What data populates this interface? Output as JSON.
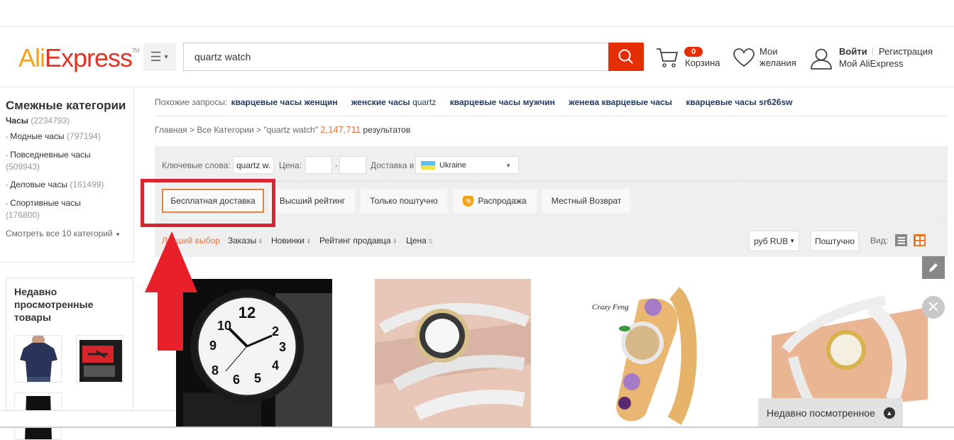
{
  "header": {
    "logo_part1": "Ali",
    "logo_part2": "Express",
    "logo_tm": "TM",
    "search_value": "quartz watch",
    "cart_count": "0",
    "cart_label": "Корзина",
    "wishlist_line1": "Мои",
    "wishlist_line2": "желания",
    "login_label": "Войти",
    "separator": "|",
    "register_label": "Регистрация",
    "my_account_label": "Мой AliExpress",
    "brand_color": "#e62e04"
  },
  "sidebar": {
    "title": "Смежные категории",
    "main_category": {
      "label": "Часы",
      "count": "(2234793)"
    },
    "items": [
      {
        "label": "Модные часы",
        "count": "(797194)"
      },
      {
        "label": "Повседневные часы",
        "count": "(509943)"
      },
      {
        "label": "Деловые часы",
        "count": "(161499)"
      },
      {
        "label": "Спортивные часы",
        "count": "(176800)"
      }
    ],
    "more_label": "Смотреть все 10 категорий",
    "recent_title": "Недавно просмотренные товары",
    "recent_items": [
      "t-shirt-navy",
      "rc-helicopter-box",
      "t-shirt-black"
    ]
  },
  "related": {
    "label": "Похожие запросы:",
    "queries": [
      {
        "bold": "кварцевые часы женщин",
        "light": ""
      },
      {
        "bold": "женские часы",
        "light": "quartz"
      },
      {
        "bold": "кварцевые часы мужчин",
        "light": ""
      },
      {
        "bold": "женева кварцевые часы",
        "light": ""
      },
      {
        "bold": "кварцевые часы sr626sw",
        "light": ""
      }
    ]
  },
  "breadcrumb": {
    "home": "Главная",
    "sep": ">",
    "all": "Все Категории",
    "query": "\"quartz watch\"",
    "count": "2,147,711",
    "results": "результатов"
  },
  "filters": {
    "keywords_label": "Ключевые слова:",
    "keywords_value": "quartz w.",
    "price_label": "Цена:",
    "price_min": "",
    "price_max": "",
    "dash": "-",
    "ship_label": "Доставка в",
    "ship_country": "Ukraine",
    "chips": [
      {
        "label": "Бесплатная доставка",
        "active": true
      },
      {
        "label": "Высший рейтинг"
      },
      {
        "label": "Только поштучно"
      },
      {
        "label": "Распродажа",
        "badge": "%"
      },
      {
        "label": "Местный Возврат"
      }
    ]
  },
  "sort": {
    "options": [
      {
        "label": "Лучший выбор",
        "arrow": ""
      },
      {
        "label": "Заказы",
        "arrow": "⬇"
      },
      {
        "label": "Новинки",
        "arrow": "⬇"
      },
      {
        "label": "Рейтинг продавца",
        "arrow": "⬇"
      },
      {
        "label": "Цена",
        "arrow": "⇅"
      }
    ],
    "currency": "руб RUB",
    "unit": "Поштучно",
    "view_label": "Вид:"
  },
  "products": [
    {
      "name": "black-sport-watch"
    },
    {
      "name": "white-crystal-wrap-watch"
    },
    {
      "name": "crazy-feng-floral-bangle-watch",
      "brand_text": "Crazy Feng"
    },
    {
      "name": "white-rhinestone-wrap-watch"
    }
  ],
  "recent_bar": {
    "label": "Недавно посмотренное"
  },
  "annotation": {
    "color": "#d9262e"
  }
}
